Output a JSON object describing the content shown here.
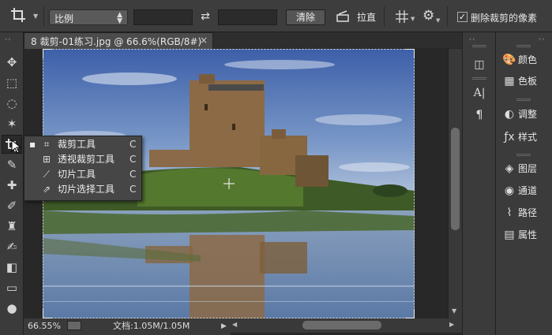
{
  "options_bar": {
    "tool_icon": "crop-icon",
    "ratio_select": "比例",
    "clear_button": "清除",
    "straighten_label": "拉直",
    "delete_cropped_checked": true,
    "delete_cropped_label": "删除裁剪的像素"
  },
  "document": {
    "tab_title": "8 裁剪-01练习.jpg @ 66.6%(RGB/8#)",
    "close_glyph": "×",
    "zoom": "66.55%",
    "doc_size": "文档:1.05M/1.05M"
  },
  "flyout": {
    "items": [
      {
        "label": "裁剪工具",
        "shortcut": "C",
        "icon": "crop-icon",
        "selected": true
      },
      {
        "label": "透视裁剪工具",
        "shortcut": "C",
        "icon": "perspective-crop-icon",
        "selected": false
      },
      {
        "label": "切片工具",
        "shortcut": "C",
        "icon": "slice-icon",
        "selected": false
      },
      {
        "label": "切片选择工具",
        "shortcut": "C",
        "icon": "slice-select-icon",
        "selected": false
      }
    ]
  },
  "panels": {
    "items": [
      {
        "label": "颜色",
        "icon": "color-palette-icon"
      },
      {
        "label": "色板",
        "icon": "swatches-icon"
      },
      {
        "label": "调整",
        "icon": "adjustments-icon"
      },
      {
        "label": "样式",
        "icon": "styles-icon"
      },
      {
        "label": "图层",
        "icon": "layers-icon"
      },
      {
        "label": "通道",
        "icon": "channels-icon"
      },
      {
        "label": "路径",
        "icon": "paths-icon"
      },
      {
        "label": "属性",
        "icon": "properties-icon"
      }
    ]
  }
}
